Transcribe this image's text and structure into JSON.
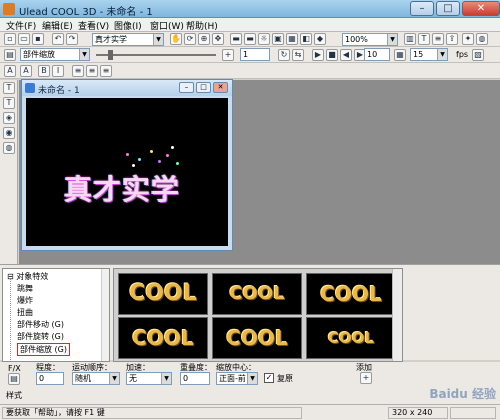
{
  "window": {
    "title": "Ulead COOL 3D - 未命名 - 1",
    "btn_min": "–",
    "btn_max": "□",
    "btn_close": "✕"
  },
  "menu": [
    "文件(F)",
    "编辑(E)",
    "查看(V)",
    "图像(I)",
    "窗口(W)",
    "帮助(H)"
  ],
  "toolbar": {
    "font_combo": "真才实学",
    "zoom_combo": "100%",
    "object_combo": "部件缩放",
    "frame_value": "1",
    "frame_total_value": "10",
    "fps_value": "15",
    "fps_label": "fps"
  },
  "document": {
    "title": "未命名 - 1",
    "text": "真才实学"
  },
  "tree": {
    "root": "对象特效",
    "items": [
      "跳舞",
      "爆炸",
      "扭曲",
      "部件移动 (G)",
      "部件旋转 (G)",
      "部件缩放 (G)"
    ]
  },
  "gallery": {
    "thumbs": [
      "COOL",
      "COOL",
      "COOL",
      "COOL",
      "COOL",
      "COOL"
    ]
  },
  "props": {
    "fx_label": "F/X",
    "density_label": "程度：",
    "density_value": "0",
    "order_label": "运动顺序：",
    "order_value": "随机",
    "accel_label": "加速：",
    "accel_value": "无",
    "overlap_label": "重叠度：",
    "overlap_value": "0",
    "center_label": "缩放中心：",
    "center_value": "正面-前",
    "restore_label": "复原",
    "add_label": "添加",
    "style_label": "样式"
  },
  "status": {
    "help": "要获取「帮助」，请按 F1 键",
    "size": "320 x 240"
  },
  "watermark": "Baidu 经验",
  "colors": {
    "highlight": "#e0261f",
    "thumb_gold": "#e8b94a"
  }
}
